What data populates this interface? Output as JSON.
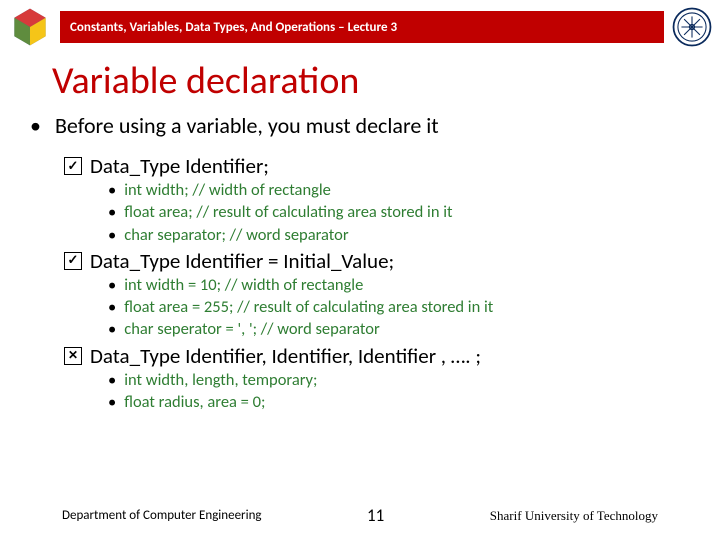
{
  "header": {
    "banner": "Constants, Variables, Data Types, And Operations – Lecture 3"
  },
  "title": "Variable declaration",
  "main_bullet": "Before using a variable, you must declare it",
  "sections": [
    {
      "mark": "tick",
      "heading": "Data_Type Identifier;",
      "items": [
        "int width;  // width of rectangle",
        "float area; // result of calculating area stored in it",
        "char separator; // word separator"
      ]
    },
    {
      "mark": "tick",
      "heading": "Data_Type Identifier = Initial_Value;",
      "items": [
        "int width = 10; // width of rectangle",
        "float area = 255; // result of calculating area stored in it",
        "char seperator = ', '; // word separator"
      ]
    },
    {
      "mark": "x",
      "heading": "Data_Type Identifier, Identifier, Identifier , …. ;",
      "items": [
        "int width, length, temporary;",
        "float radius, area = 0;"
      ]
    }
  ],
  "footer": {
    "dept": "Department of Computer Engineering",
    "page": "11",
    "uni": "Sharif University of Technology"
  }
}
